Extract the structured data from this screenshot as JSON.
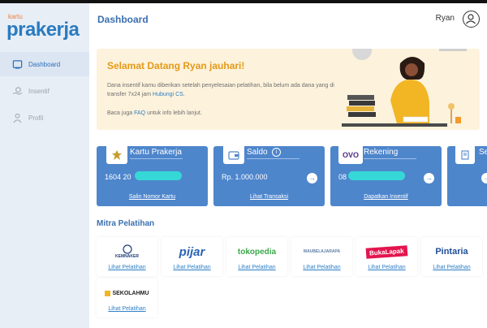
{
  "sidebar": {
    "logo_small": "kartu",
    "logo_big": "prakerja",
    "items": [
      {
        "label": "Dashboard",
        "icon": "home-icon"
      },
      {
        "label": "Insentif",
        "icon": "money-hand-icon"
      },
      {
        "label": "Profil",
        "icon": "person-icon"
      }
    ]
  },
  "header": {
    "title": "Dashboard",
    "user": "Ryan"
  },
  "banner": {
    "title": "Selamat Datang Ryan jauhari!",
    "line1": "Dana insentif kamu diberikan setelah penyelesaian pelatihan, bila belum ada dana yang di transfer 7x24 jam",
    "line1_link": "Hubungi CS.",
    "line2_pre": "Baca juga",
    "line2_link": "FAQ",
    "line2_post": "untuk info lebih lanjut."
  },
  "cards": [
    {
      "title": "Kartu Prakerja",
      "value": "1604 20",
      "link": "Salin Nomor Kartu",
      "icon": "garuda-emblem-icon"
    },
    {
      "title": "Saldo",
      "value": "Rp. 1.000.000",
      "link": "Lihat Transaksi",
      "icon": "wallet-icon"
    },
    {
      "title": "Rekening",
      "value": "08",
      "link": "Dapatkan Insentif",
      "icon": "ovo-logo-icon",
      "icon_text": "OVO"
    },
    {
      "title": "Se",
      "value": "",
      "link": "",
      "icon": "certificate-icon"
    }
  ],
  "mitra": {
    "title": "Mitra Pelatihan",
    "link_label": "Lihat Pelatihan",
    "partners": [
      {
        "name": "KEMNAKER",
        "color": "#1f3d7a"
      },
      {
        "name": "pijar",
        "color": "#2a63b8"
      },
      {
        "name": "tokopedia",
        "color": "#3ca84b"
      },
      {
        "name": "MAUBELAJARAPA",
        "color": "#5f7fa6"
      },
      {
        "name": "BukaLapak",
        "color": "#e3154e"
      },
      {
        "name": "Pintaria",
        "color": "#1f4e99"
      },
      {
        "name": "SEKOLAHMU",
        "color": "#222222"
      }
    ]
  },
  "colors": {
    "accent": "#4e86cc",
    "banner": "#fdf2dc",
    "sidebar": "#e7eef6"
  }
}
